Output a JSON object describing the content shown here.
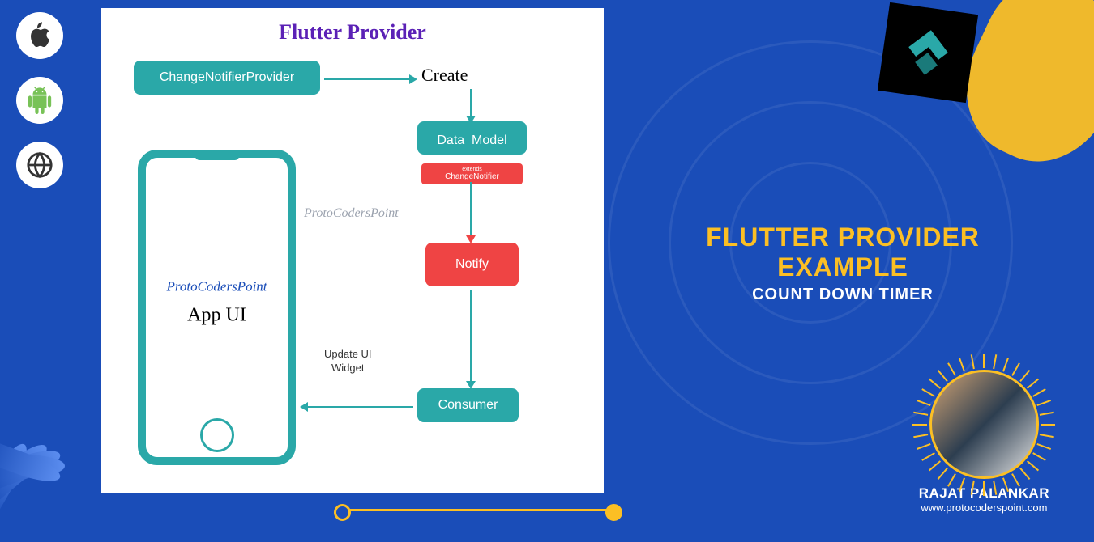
{
  "diagram": {
    "title": "Flutter Provider",
    "boxes": {
      "change_notifier_provider": "ChangeNotifierProvider",
      "create": "Create",
      "data_model": "Data_Model",
      "extends_label": "extends",
      "change_notifier": "ChangeNotifier",
      "notify": "Notify",
      "consumer": "Consumer"
    },
    "watermark": "ProtoCodersPoint",
    "update_label": "Update UI\nWidget",
    "phone": {
      "brand": "ProtoCodersPoint",
      "label": "App UI"
    }
  },
  "main": {
    "title": "FLUTTER PROVIDER EXAMPLE",
    "subtitle": "COUNT DOWN TIMER"
  },
  "author": {
    "name": "RAJAT PALANKAR",
    "url": "www.protocoderspoint.com"
  },
  "icons": {
    "apple": "apple-icon",
    "android": "android-icon",
    "web": "globe-icon"
  }
}
